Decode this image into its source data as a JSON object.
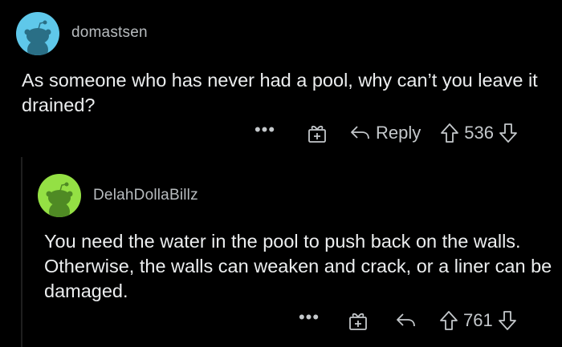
{
  "comments": [
    {
      "username": "domastsen",
      "body": "As someone who has never had a pool, why can’t you leave it drained?",
      "more": "•••",
      "reply_label": "Reply",
      "score": "536",
      "avatar_color": "#5fc8ea"
    },
    {
      "username": "DelahDollaBillz",
      "body": "You need the water in the pool to push back on the walls. Otherwise, the walls can weaken and crack, or a liner can be damaged.",
      "more": "•••",
      "score": "761",
      "avatar_color": "#94e044"
    }
  ],
  "icons": {
    "gift": "gift-icon",
    "reply": "reply-arrow-icon",
    "upvote": "upvote-arrow-icon",
    "downvote": "downvote-arrow-icon"
  },
  "colors": {
    "background": "#000000",
    "text": "#eceeef",
    "muted": "#b8bcbf"
  }
}
